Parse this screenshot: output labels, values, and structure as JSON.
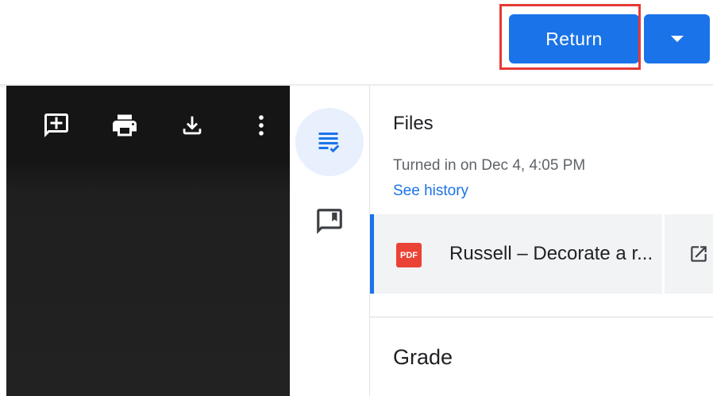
{
  "header": {
    "return_label": "Return",
    "dropdown_icon": "caret-down-icon"
  },
  "viewer": {
    "toolbar_icons": [
      "add-comment-icon",
      "print-icon",
      "download-icon",
      "more-vert-icon"
    ]
  },
  "rail": {
    "items": [
      "files-tab-icon",
      "private-comment-icon"
    ]
  },
  "panel": {
    "files_heading": "Files",
    "turned_in_text": "Turned in on Dec 4, 4:05 PM",
    "see_history_label": "See history",
    "file": {
      "type_badge": "PDF",
      "name": "Russell – Decorate a r..."
    },
    "grade_heading": "Grade"
  },
  "colors": {
    "accent": "#1a73e8",
    "highlight": "#e53935",
    "pdf_red": "#ea4335",
    "viewer_bg": "#151515"
  }
}
